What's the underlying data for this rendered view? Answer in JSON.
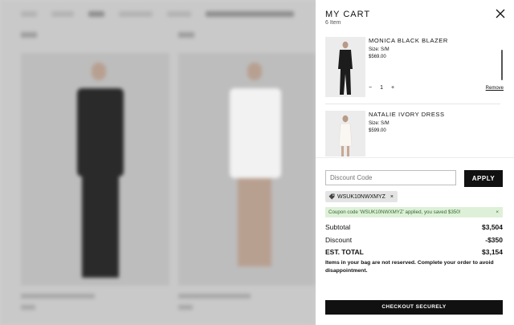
{
  "cart": {
    "title": "MY CART",
    "count": "6 Item",
    "items": [
      {
        "name": "MONICA BLACK BLAZER",
        "size": "Size: S/M",
        "price": "$569.00",
        "qty": "1",
        "minus": "−",
        "plus": "+",
        "remove": "Remove"
      },
      {
        "name": "NATALIE IVORY DRESS",
        "size": "Size: S/M",
        "price": "$599.00"
      }
    ],
    "discount": {
      "placeholder": "Discount Code",
      "apply": "APPLY"
    },
    "coupon": {
      "code": "WSUK10NWXMYZ",
      "remove": "×",
      "message": "Coupon code 'WSUK10NWXMYZ' applied, you saved $350!",
      "dismiss": "×"
    },
    "summary": {
      "subtotal_label": "Subtotal",
      "subtotal": "$3,504",
      "discount_label": "Discount",
      "discount": "-$350",
      "total_label": "EST. TOTAL",
      "total": "$3,154"
    },
    "notice": "Items in your bag are not reserved. Complete your order to avoid disappointment.",
    "checkout": "CHECKOUT SECURELY"
  },
  "icons": {
    "close": "close-icon",
    "tag": "tag-icon"
  },
  "colors": {
    "button": "#111111",
    "success_bg": "#dff0d8",
    "success_text": "#2f6b2f"
  }
}
